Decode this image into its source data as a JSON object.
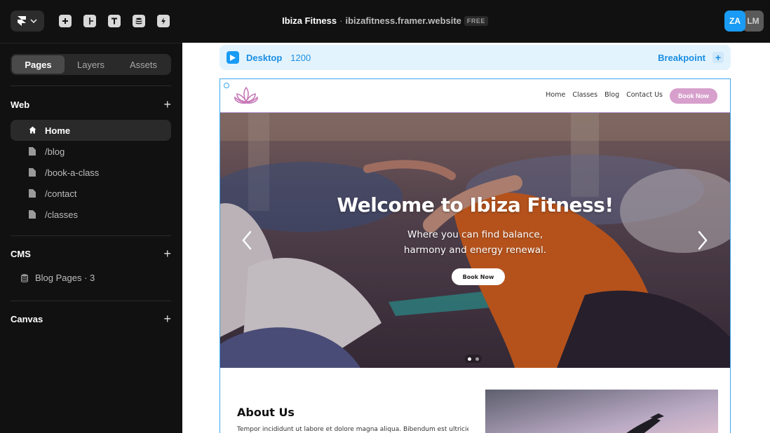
{
  "topbar": {
    "site_name": "Ibiza Fitness",
    "separator": "·",
    "url": "ibizafitness.framer.website",
    "plan_badge": "FREE",
    "avatars": [
      {
        "initials": "ZA",
        "color": "#1a9bf5"
      },
      {
        "initials": "LM",
        "color": "#5a5a5a"
      }
    ],
    "tools": [
      "insert-icon",
      "layout-icon",
      "text-icon",
      "cms-icon",
      "assets-bolt-icon"
    ]
  },
  "sidebar": {
    "tabs": [
      "Pages",
      "Layers",
      "Assets"
    ],
    "active_tab": "Pages",
    "web": {
      "heading": "Web",
      "add": "+",
      "pages": [
        {
          "label": "Home",
          "icon": "home-icon",
          "active": true
        },
        {
          "label": "/blog",
          "icon": "page-icon",
          "active": false
        },
        {
          "label": "/book-a-class",
          "icon": "page-icon",
          "active": false
        },
        {
          "label": "/contact",
          "icon": "page-icon",
          "active": false
        },
        {
          "label": "/classes",
          "icon": "page-icon",
          "active": false
        }
      ]
    },
    "cms": {
      "heading": "CMS",
      "add": "+",
      "items": [
        {
          "label": "Blog Pages · 3",
          "icon": "database-icon"
        }
      ]
    },
    "canvas": {
      "heading": "Canvas",
      "add": "+"
    }
  },
  "canvas": {
    "breakpoint_bar": {
      "label": "Desktop",
      "width": "1200",
      "right_label": "Breakpoint",
      "add": "+",
      "accent": "#1a9bf5"
    },
    "site": {
      "nav_links": [
        "Home",
        "Classes",
        "Blog",
        "Contact Us"
      ],
      "nav_button": "Book Now",
      "nav_button_color": "#d79fcc",
      "hero": {
        "title": "Welcome to Ibiza Fitness!",
        "subtitle_line1": "Where you can find balance,",
        "subtitle_line2": "harmony and energy renewal.",
        "button": "Book Now",
        "slide_count": 2,
        "active_slide": 1
      },
      "about": {
        "title": "About Us",
        "text": "Tempor incididunt ut labore et dolore magna aliqua. Bibendum est ultricies"
      }
    }
  }
}
